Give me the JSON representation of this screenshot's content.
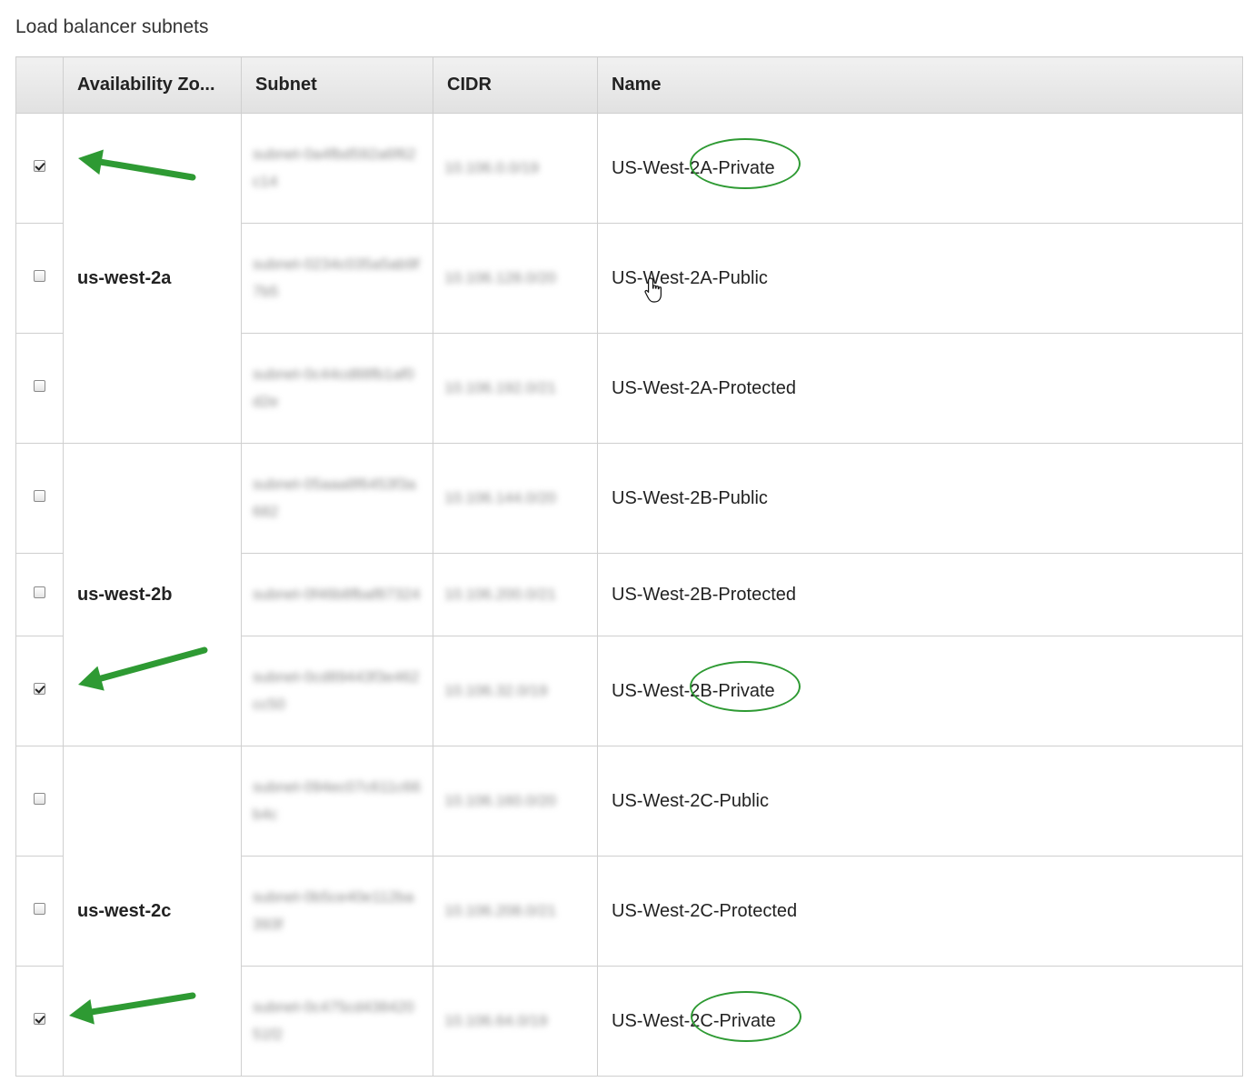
{
  "section": {
    "title": "Load balancer subnets"
  },
  "table": {
    "headers": {
      "select": "",
      "availability_zone": "Availability Zo...",
      "subnet": "Subnet",
      "cidr": "CIDR",
      "name": "Name"
    },
    "zones": [
      "us-west-2a",
      "us-west-2b",
      "us-west-2c"
    ],
    "rows": [
      {
        "checked": true,
        "subnet": "subnet-0a4fbd592a6f62c14",
        "cidr": "10.106.0.0/19",
        "name": "US-West-2A-Private",
        "highlighted": true
      },
      {
        "checked": false,
        "subnet": "subnet-0234c035a5ab9f7b5",
        "cidr": "10.106.128.0/20",
        "name": "US-West-2A-Public",
        "highlighted": false
      },
      {
        "checked": false,
        "subnet": "subnet-0c44cd88fb1af0d2e",
        "cidr": "10.106.192.0/21",
        "name": "US-West-2A-Protected",
        "highlighted": false
      },
      {
        "checked": false,
        "subnet": "subnet-05aaa8f6453f3a682",
        "cidr": "10.106.144.0/20",
        "name": "US-West-2B-Public",
        "highlighted": false
      },
      {
        "checked": false,
        "subnet": "subnet-0f46b8fbaf87324",
        "cidr": "10.106.200.0/21",
        "name": "US-West-2B-Protected",
        "highlighted": false
      },
      {
        "checked": true,
        "subnet": "subnet-0cd89443f3e462cc50",
        "cidr": "10.106.32.0/19",
        "name": "US-West-2B-Private",
        "highlighted": true
      },
      {
        "checked": false,
        "subnet": "subnet-094ec07c611c66b4c",
        "cidr": "10.106.160.0/20",
        "name": "US-West-2C-Public",
        "highlighted": false
      },
      {
        "checked": false,
        "subnet": "subnet-0b5ce40e112ba393f",
        "cidr": "10.106.208.0/21",
        "name": "US-West-2C-Protected",
        "highlighted": false
      },
      {
        "checked": true,
        "subnet": "subnet-0c475cd43842051f2",
        "cidr": "10.106.64.0/19",
        "name": "US-West-2C-Private",
        "highlighted": true
      }
    ]
  },
  "annotations": {
    "color": "#2e9a33"
  }
}
